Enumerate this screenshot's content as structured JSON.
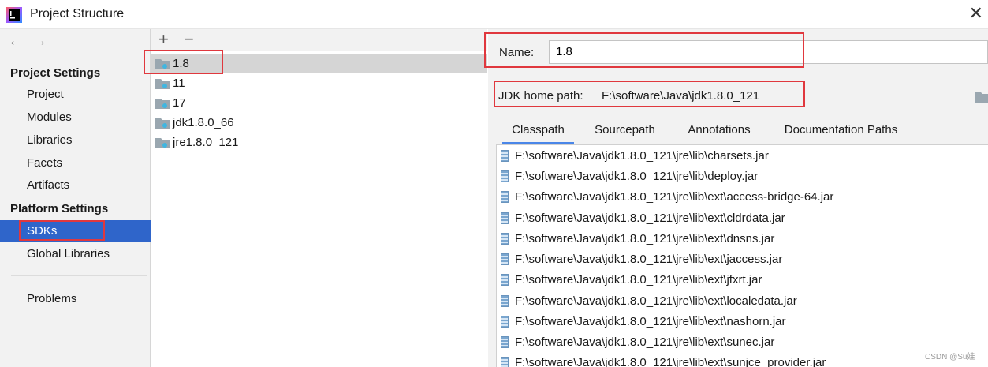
{
  "window": {
    "title": "Project Structure",
    "app_icon": "intellij-icon",
    "close_icon": "close-icon"
  },
  "sidebar": {
    "back_icon": "back-arrow-icon",
    "forward_icon": "forward-arrow-icon",
    "project_settings_header": "Project Settings",
    "project_settings_items": [
      {
        "label": "Project"
      },
      {
        "label": "Modules"
      },
      {
        "label": "Libraries"
      },
      {
        "label": "Facets"
      },
      {
        "label": "Artifacts"
      }
    ],
    "platform_settings_header": "Platform Settings",
    "platform_settings_items": [
      {
        "label": "SDKs",
        "selected": true
      },
      {
        "label": "Global Libraries"
      }
    ],
    "problems_label": "Problems",
    "selected_color": "#2f65ca"
  },
  "sdk_list": {
    "add_icon": "plus-icon",
    "remove_icon": "minus-icon",
    "add_label": "+",
    "remove_label": "−",
    "items": [
      {
        "label": "1.8",
        "selected": true
      },
      {
        "label": "11"
      },
      {
        "label": "17"
      },
      {
        "label": "jdk1.8.0_66"
      },
      {
        "label": "jre1.8.0_121"
      }
    ]
  },
  "details": {
    "name_label": "Name:",
    "name_value": "1.8",
    "jdk_home_label": "JDK home path:",
    "jdk_home_value": "F:\\software\\Java\\jdk1.8.0_121",
    "browse_icon": "folder-icon",
    "tabs": [
      {
        "label": "Classpath",
        "active": true
      },
      {
        "label": "Sourcepath"
      },
      {
        "label": "Annotations"
      },
      {
        "label": "Documentation Paths"
      }
    ],
    "classpath": [
      "F:\\software\\Java\\jdk1.8.0_121\\jre\\lib\\charsets.jar",
      "F:\\software\\Java\\jdk1.8.0_121\\jre\\lib\\deploy.jar",
      "F:\\software\\Java\\jdk1.8.0_121\\jre\\lib\\ext\\access-bridge-64.jar",
      "F:\\software\\Java\\jdk1.8.0_121\\jre\\lib\\ext\\cldrdata.jar",
      "F:\\software\\Java\\jdk1.8.0_121\\jre\\lib\\ext\\dnsns.jar",
      "F:\\software\\Java\\jdk1.8.0_121\\jre\\lib\\ext\\jaccess.jar",
      "F:\\software\\Java\\jdk1.8.0_121\\jre\\lib\\ext\\jfxrt.jar",
      "F:\\software\\Java\\jdk1.8.0_121\\jre\\lib\\ext\\localedata.jar",
      "F:\\software\\Java\\jdk1.8.0_121\\jre\\lib\\ext\\nashorn.jar",
      "F:\\software\\Java\\jdk1.8.0_121\\jre\\lib\\ext\\sunec.jar",
      "F:\\software\\Java\\jdk1.8.0_121\\jre\\lib\\ext\\sunjce_provider.jar"
    ]
  },
  "annotation_color": "#e0383e",
  "watermark": "CSDN @Su娃"
}
